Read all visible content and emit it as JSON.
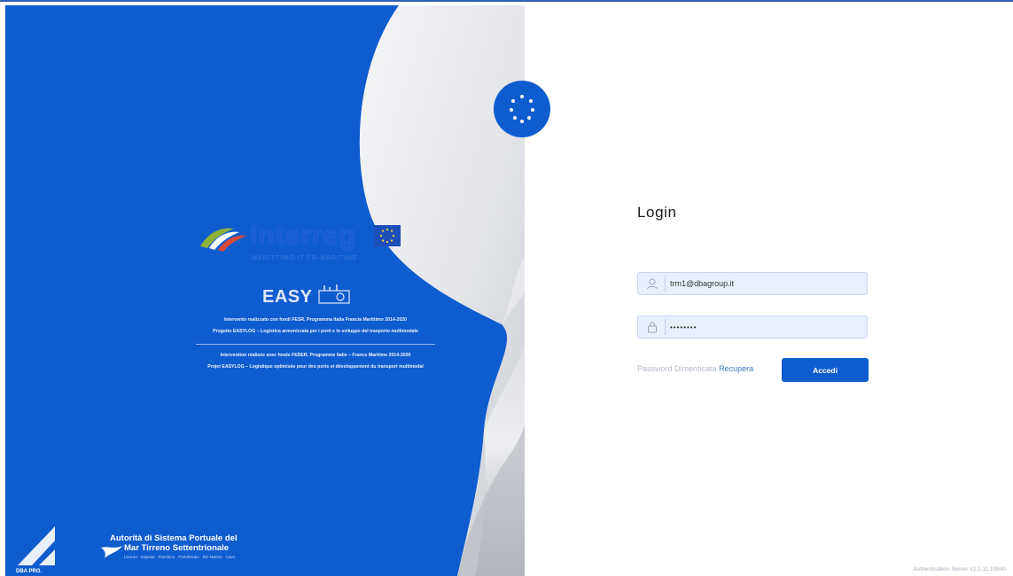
{
  "branding": {
    "program_name": "Interreg",
    "program_subtitle": "MARITTIMO-IT FR-MARITIME",
    "project_name": "EASY",
    "funding_lines": [
      "Intervento realizzato con fondi FESR, Programma Italia Francia Marittimo 2014-2020",
      "Progetto EASYLOG – Logistica armonizzata per i porti e lo sviluppo del trasporto multimodale",
      "Intervention réalisée avec fonds FEDER, Programme Italie – France Maritime 2014-2020",
      "Projet EASYLOG – Logistique optimisée pour des ports et développement du transport multimodal"
    ],
    "dba_label": "DBA PRO.",
    "authority_line1": "Autorità di Sistema Portuale del",
    "authority_line2": "Mar Tirreno Settentrionale",
    "authority_line3": "Livorno · Capraia · Piombino · Portoferraio · Rio Marina · Cavo"
  },
  "login": {
    "title": "Login",
    "email_value": "trm1@dbagroup.it",
    "email_icon": "user-icon",
    "password_value": "••••••••",
    "password_icon": "lock-icon",
    "forgot_label": "Password Dimenticata",
    "recover_label": "Recupera",
    "submit_label": "Accedi"
  },
  "footer": {
    "version": "Authentication Server v2.2.11.10840"
  },
  "colors": {
    "brand_blue": "#0f5ccf",
    "field_bg": "#e8f0fd",
    "link_blue": "#3d78c8"
  }
}
